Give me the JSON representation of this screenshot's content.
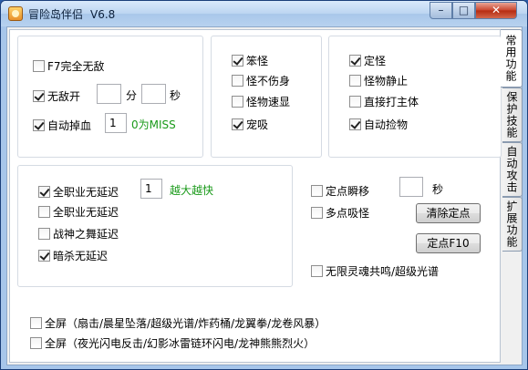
{
  "window": {
    "title": "冒险岛伴侣",
    "version": "V6.8",
    "controls": {
      "minimize": "–",
      "maximize": "□",
      "close": "✕"
    }
  },
  "tabs": [
    "常用功能",
    "保护技能",
    "自动攻击",
    "扩展功能"
  ],
  "group1": {
    "f7": {
      "label": "F7完全无敌",
      "checked": false
    },
    "invincible": {
      "label": "无敌开",
      "checked": true,
      "minutes": "",
      "minutes_unit": "分",
      "seconds": "",
      "seconds_unit": "秒"
    },
    "auto_drop_hp": {
      "label": "自动掉血",
      "checked": true,
      "value": "1",
      "hint": "0为MISS"
    }
  },
  "group2": {
    "items": [
      {
        "label": "笨怪",
        "checked": true
      },
      {
        "label": "怪不伤身",
        "checked": false
      },
      {
        "label": "怪物速显",
        "checked": false
      },
      {
        "label": "宠吸",
        "checked": true
      }
    ]
  },
  "group3": {
    "items": [
      {
        "label": "定怪",
        "checked": true
      },
      {
        "label": "怪物静止",
        "checked": false
      },
      {
        "label": "直接打主体",
        "checked": false
      },
      {
        "label": "自动捡物",
        "checked": true
      }
    ]
  },
  "group4": {
    "items": [
      {
        "label": "全职业无延迟",
        "checked": true
      },
      {
        "label": "全职业无延迟",
        "checked": false
      },
      {
        "label": "战神之舞延迟",
        "checked": false
      },
      {
        "label": "暗杀无延迟",
        "checked": true
      }
    ],
    "speed_value": "1",
    "speed_hint": "越大越快"
  },
  "right_area": {
    "teleport": {
      "label": "定点瞬移",
      "checked": false,
      "seconds": "",
      "seconds_unit": "秒"
    },
    "multi_suck": {
      "label": "多点吸怪",
      "checked": false
    },
    "clear_btn": "清除定点",
    "set_btn": "定点F10",
    "soul": {
      "label": "无限灵魂共鸣/超级光谱",
      "checked": false
    }
  },
  "bottom": {
    "fullscreen1": {
      "label": "全屏（扇击/晨星坠落/超级光谱/炸药桶/龙翼拳/龙卷风暴）",
      "checked": false
    },
    "fullscreen2": {
      "label": "全屏（夜光闪电反击/幻影冰雷链环闪电/龙神熊熊烈火）",
      "checked": false
    }
  }
}
